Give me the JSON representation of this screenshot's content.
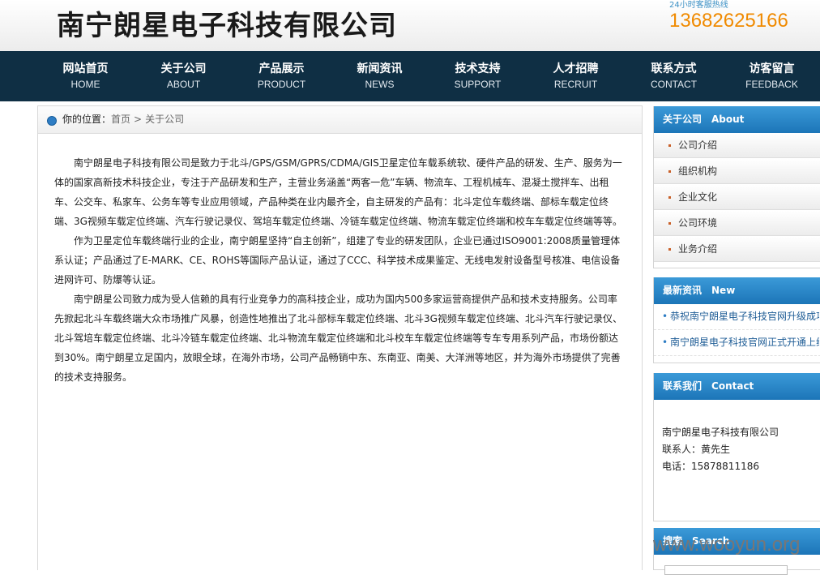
{
  "header": {
    "company_name": "南宁朗星电子科技有限公司",
    "hotline_label": "24小时客服热线",
    "hotline_number": "13682625166"
  },
  "nav": [
    {
      "zh": "网站首页",
      "en": "HOME"
    },
    {
      "zh": "关于公司",
      "en": "ABOUT"
    },
    {
      "zh": "产品展示",
      "en": "PRODUCT"
    },
    {
      "zh": "新闻资讯",
      "en": "NEWS"
    },
    {
      "zh": "技术支持",
      "en": "SUPPORT"
    },
    {
      "zh": "人才招聘",
      "en": "RECRUIT"
    },
    {
      "zh": "联系方式",
      "en": "CONTACT"
    },
    {
      "zh": "访客留言",
      "en": "FEEDBACK"
    }
  ],
  "breadcrumb": {
    "label": "你的位置：",
    "home": "首页",
    "separator": ">",
    "current": "关于公司"
  },
  "content": {
    "paragraphs": [
      "南宁朗星电子科技有限公司是致力于北斗/GPS/GSM/GPRS/CDMA/GIS卫星定位车载系统软、硬件产品的研发、生产、服务为一体的国家高新技术科技企业，专注于产品研发和生产，主营业务涵盖“两客一危”车辆、物流车、工程机械车、混凝土搅拌车、出租车、公交车、私家车、公务车等专业应用领域，产品种类在业内最齐全，自主研发的产品有：北斗定位车载终端、部标车载定位终端、3G视频车载定位终端、汽车行驶记录仪、驾培车载定位终端、冷链车载定位终端、物流车载定位终端和校车车载定位终端等等。",
      "作为卫星定位车载终端行业的企业，南宁朗星坚持“自主创新”，组建了专业的研发团队，企业已通过ISO9001:2008质量管理体系认证；产品通过了E-MARK、CE、ROHS等国际产品认证，通过了CCC、科学技术成果鉴定、无线电发射设备型号核准、电信设备进网许可、防爆等认证。",
      "南宁朗星公司致力成为受人信赖的具有行业竞争力的高科技企业，成功为国内500多家运营商提供产品和技术支持服务。公司率先掀起北斗车载终端大众市场推广风暴，创造性地推出了北斗部标车载定位终端、北斗3G视频车载定位终端、北斗汽车行驶记录仪、北斗驾培车载定位终端、北斗冷链车载定位终端、北斗物流车载定位终端和北斗校车车载定位终端等专车专用系列产品，市场份额达到30%。南宁朗星立足国内，放眼全球，在海外市场，公司产品畅销中东、东南亚、南美、大洋洲等地区，并为海外市场提供了完善的技术支持服务。"
    ]
  },
  "sidebar": {
    "about": {
      "title_zh": "关于公司",
      "title_en": "About",
      "items": [
        "公司介绍",
        "组织机构",
        "企业文化",
        "公司环境",
        "业务介绍"
      ]
    },
    "news": {
      "title_zh": "最新资讯",
      "title_en": "New",
      "items": [
        "恭祝南宁朗星电子科技官网升级成功",
        "南宁朗星电子科技官网正式开通上线"
      ]
    },
    "contact": {
      "title_zh": "联系我们",
      "title_en": "Contact",
      "company": "南宁朗星电子科技有限公司",
      "person": "联系人：黄先生",
      "phone": "电话：15878811186"
    },
    "search": {
      "title_zh": "搜索",
      "title_en": "Search"
    }
  },
  "watermark": "www.wooyun.org"
}
